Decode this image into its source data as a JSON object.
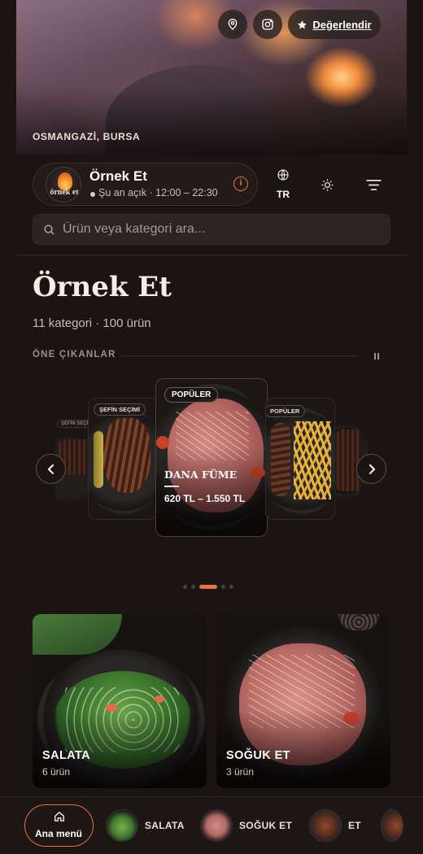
{
  "hero": {
    "location": "OSMANGAZİ, BURSA",
    "rate_label": "Değerlendir",
    "icons": [
      "map-pin-icon",
      "instagram-icon",
      "star-icon"
    ]
  },
  "brand": {
    "name": "Örnek Et",
    "logo_text": "örnek et",
    "status": "Şu an açık",
    "hours": "12:00 – 22:30",
    "hours_line": "Şu an açık · 12:00 – 22:30"
  },
  "header": {
    "language": "TR",
    "icons": [
      "info-icon",
      "globe-icon",
      "sun-icon",
      "filter-icon"
    ]
  },
  "search": {
    "placeholder": "Ürün veya kategori ara..."
  },
  "menu": {
    "title": "Örnek Et",
    "stats": "11 kategori · 100 ürün",
    "featured_label": "ÖNE ÇIKANLAR"
  },
  "carousel": {
    "badges": {
      "far_left": "ŞEFİN SEÇİMİ",
      "mid_left": "ŞEFİN SEÇİMİ",
      "main": "POPÜLER",
      "mid_right": "POPÜLER"
    },
    "main_item": {
      "name": "DANA FÜME",
      "price": "620 TL – 1.550 TL"
    },
    "dots": 5,
    "active_dot": 3
  },
  "categories": [
    {
      "name": "SALATA",
      "count": "6 ürün"
    },
    {
      "name": "SOĞUK ET",
      "count": "3 ürün"
    }
  ],
  "bottom_nav": {
    "home": "Ana menü",
    "items": [
      "SALATA",
      "SOĞUK ET",
      "ET"
    ]
  },
  "colors": {
    "accent": "#e0743a",
    "background": "#1a1412"
  }
}
